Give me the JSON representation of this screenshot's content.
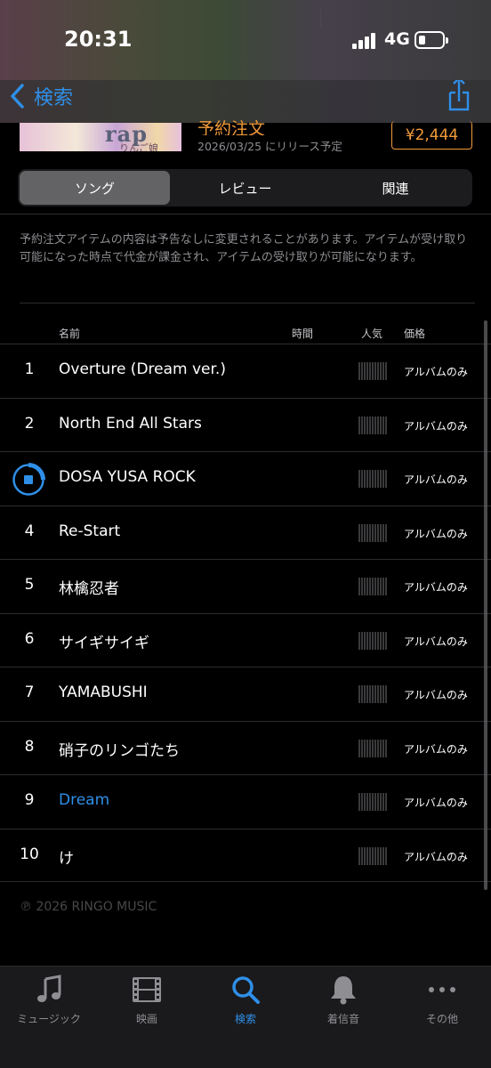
{
  "status": {
    "time": "20:31",
    "network": "4G"
  },
  "nav": {
    "back_label": "検索",
    "icons": {
      "back": "chevron-left-icon",
      "share": "share-icon"
    }
  },
  "album": {
    "art_title": "rap",
    "art_subtitle": "りんご娘",
    "preorder_label": "予約注文",
    "release_note": "2026/03/25 にリリース予定",
    "price": "¥2,444"
  },
  "tabs": [
    {
      "label": "ソング",
      "active": true
    },
    {
      "label": "レビュー",
      "active": false
    },
    {
      "label": "関連",
      "active": false
    }
  ],
  "notice": "予約注文アイテムの内容は予告なしに変更されることがあります。アイテムが受け取り可能になった時点で代金が課金され、アイテムの受け取りが可能になります。",
  "table": {
    "headers": {
      "name": "名前",
      "time": "時間",
      "popularity": "人気",
      "price": "価格"
    },
    "tracks": [
      {
        "num": "1",
        "name": "Overture (Dream ver.)",
        "price": "アルバムのみ"
      },
      {
        "num": "2",
        "name": "North End All Stars",
        "price": "アルバムのみ"
      },
      {
        "num": "3",
        "name": "DOSA YUSA ROCK",
        "price": "アルバムのみ",
        "playing": true
      },
      {
        "num": "4",
        "name": "Re-Start",
        "price": "アルバムのみ"
      },
      {
        "num": "5",
        "name": "林檎忍者",
        "price": "アルバムのみ"
      },
      {
        "num": "6",
        "name": "サイギサイギ",
        "price": "アルバムのみ"
      },
      {
        "num": "7",
        "name": "YAMABUSHI",
        "price": "アルバムのみ"
      },
      {
        "num": "8",
        "name": "硝子のリンゴたち",
        "price": "アルバムのみ"
      },
      {
        "num": "9",
        "name": "Dream",
        "price": "アルバムのみ",
        "highlighted": true
      },
      {
        "num": "10",
        "name": "け",
        "price": "アルバムのみ"
      }
    ]
  },
  "copyright": "℗ 2026 RINGO MUSIC",
  "tabbar": [
    {
      "label": "ミュージック",
      "icon": "music-note-icon",
      "active": false
    },
    {
      "label": "映画",
      "icon": "film-icon",
      "active": false
    },
    {
      "label": "検索",
      "icon": "search-icon",
      "active": true
    },
    {
      "label": "着信音",
      "icon": "bell-icon",
      "active": false
    },
    {
      "label": "その他",
      "icon": "more-icon",
      "active": false
    }
  ],
  "colors": {
    "accent": "#2f8fe8",
    "price": "#f39a3a",
    "background": "#000000"
  }
}
